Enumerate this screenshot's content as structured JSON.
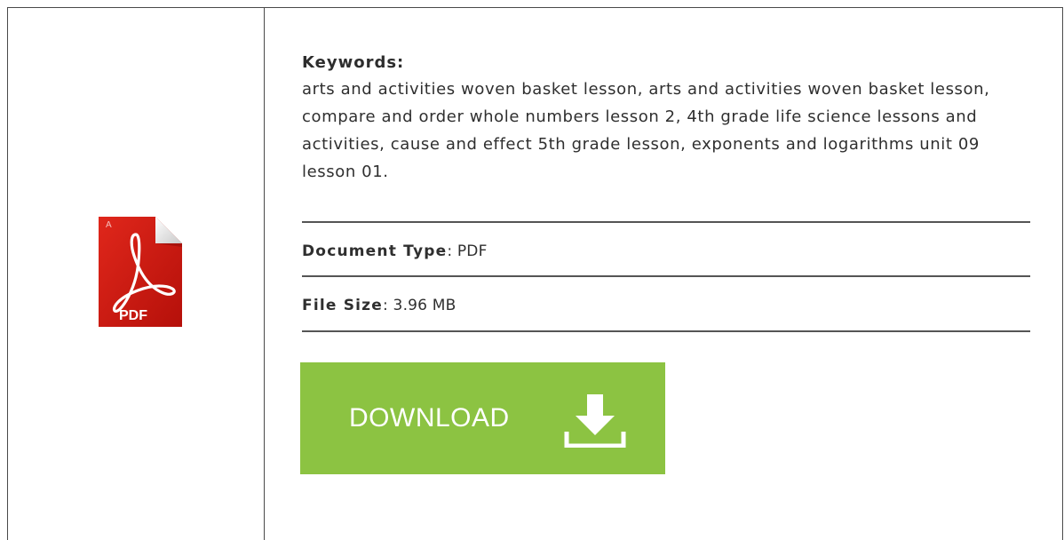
{
  "document": {
    "keywords_label": "Keywords",
    "keywords_colon": ":",
    "keywords_text": "arts and activities woven basket lesson, arts and activities woven basket lesson, compare and order whole numbers lesson 2, 4th grade life science lessons and activities, cause and effect 5th grade lesson, exponents and logarithms unit 09 lesson 01.",
    "document_type_label": "Document Type",
    "document_type_value": ": PDF",
    "file_size_label": "File Size",
    "file_size_value": ": 3.96 MB"
  },
  "icon": {
    "name": "pdf-file-icon",
    "text": "PDF"
  },
  "download": {
    "label": "DOWNLOAD",
    "icon": "download-arrow-icon",
    "color": "#8cc342"
  },
  "colors": {
    "pdf_red": "#c8160d",
    "border": "#4a4a4a",
    "text": "#2f2f2f"
  }
}
